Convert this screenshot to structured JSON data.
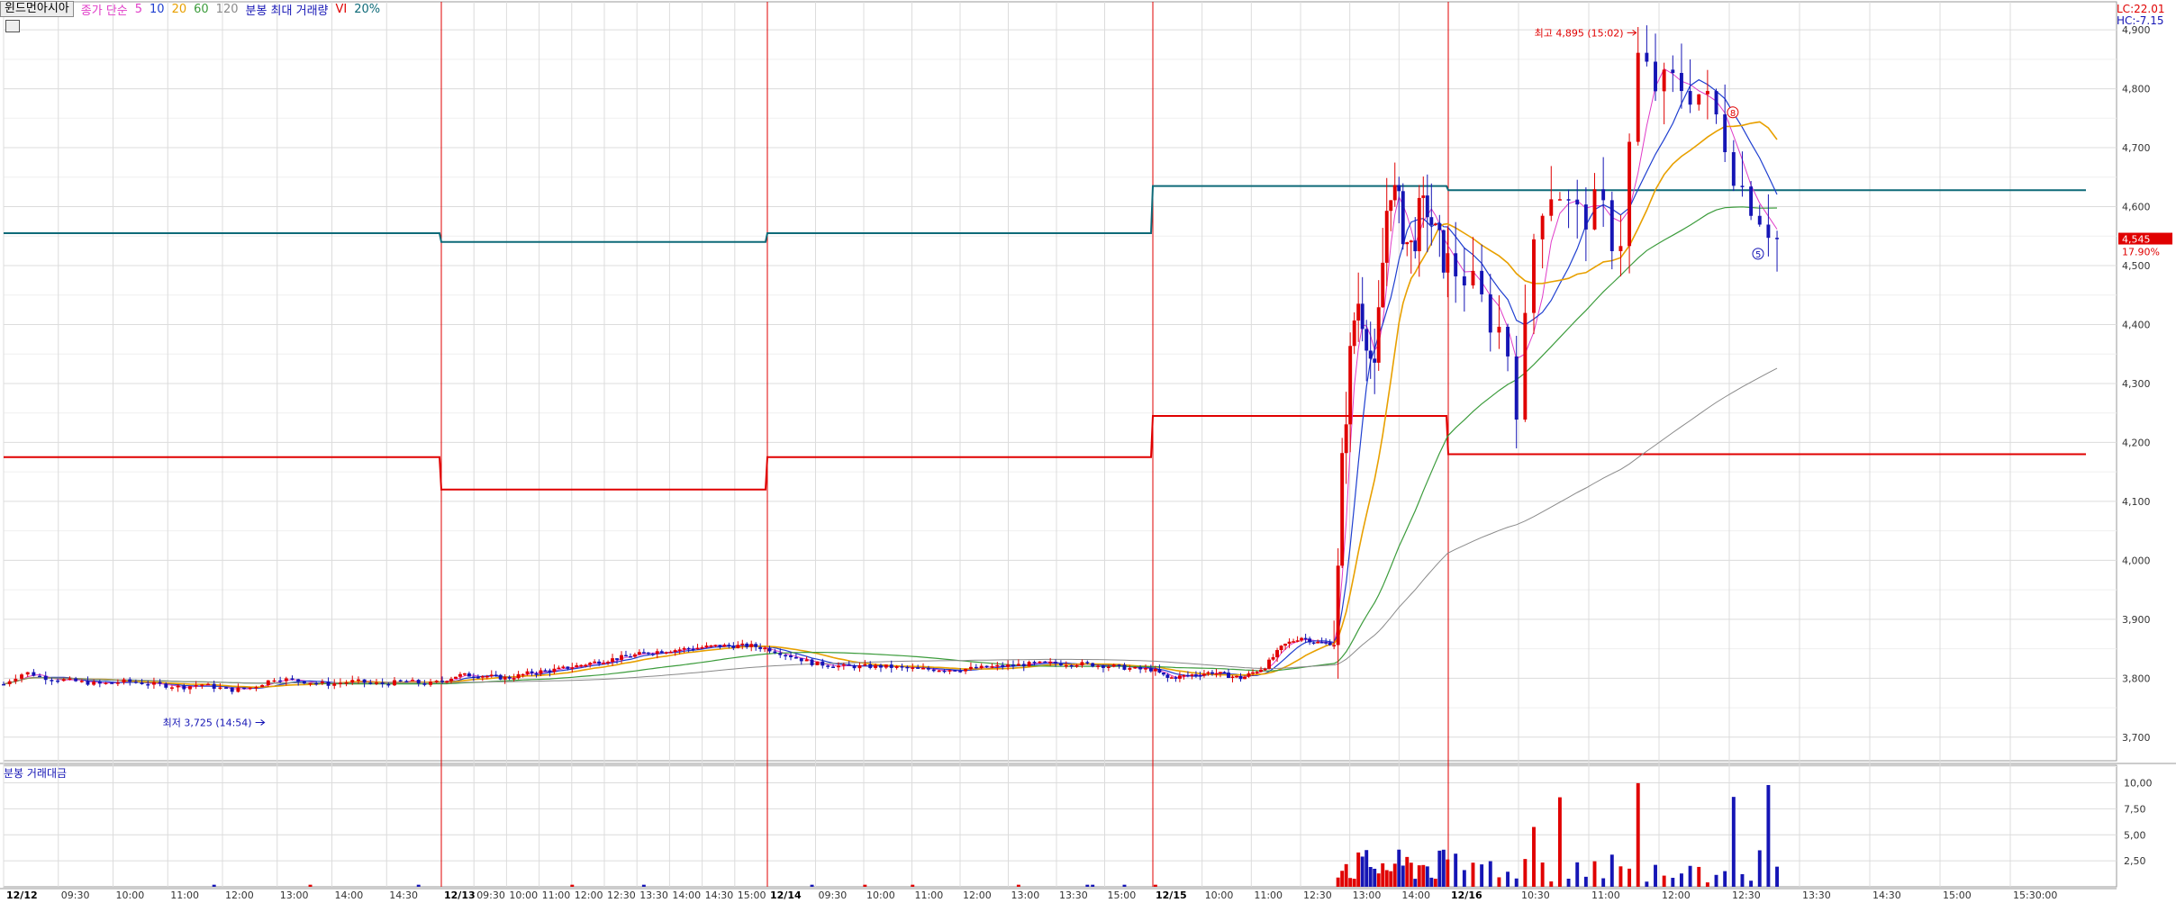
{
  "legend": {
    "stock_name": "윈드먼아시아",
    "ma_label": "종가 단순",
    "ma5": "5",
    "ma10": "10",
    "ma20": "20",
    "ma60": "60",
    "ma120": "120",
    "vol_label": "분봉 최대 거래량",
    "vi_label": "VI",
    "vi_pct": "20%"
  },
  "corner": {
    "lc": "LC:22.01",
    "hc": "HC:-7.15"
  },
  "volume_panel": {
    "label": "분봉 거래대금"
  },
  "colors": {
    "up": "#e00000",
    "down": "#1515b5",
    "ma5": "#e03cc8",
    "ma10": "#1f3fd0",
    "ma20": "#e8a000",
    "ma60": "#3c9c3c",
    "ma120": "#8a8a8a",
    "vi_upper": "#0e6a78",
    "vi_lower": "#e00000",
    "day_sep": "#e00000",
    "grid": "#dcdcdc"
  },
  "chart_data": {
    "type": "candlestick",
    "price_ylim": [
      3660,
      4920
    ],
    "price_ticks": [
      "3,700",
      "3,800",
      "3,900",
      "4,000",
      "4,100",
      "4,200",
      "4,300",
      "4,400",
      "4,500",
      "4,600",
      "4,700",
      "4,800",
      "4,900"
    ],
    "volume_ticks": [
      "2,50",
      "5,00",
      "7,50",
      "10,00"
    ],
    "volume_ylim": [
      0,
      11
    ],
    "current_price": "4,545",
    "current_change": "17.90%",
    "high_note": "최고 4,895 (15:02)",
    "low_note": "최저 3,725 (14:54)",
    "marker_upper": "8",
    "marker_lower": "5",
    "days": [
      "12/12",
      "12/13",
      "12/14",
      "12/15",
      "12/16"
    ],
    "time_labels": [
      {
        "t": "12/12",
        "day": true
      },
      {
        "t": "09:30"
      },
      {
        "t": "10:00"
      },
      {
        "t": "11:00"
      },
      {
        "t": "12:00"
      },
      {
        "t": "13:00"
      },
      {
        "t": "14:00"
      },
      {
        "t": "14:30"
      },
      {
        "t": "12/13",
        "day": true
      },
      {
        "t": "09:30"
      },
      {
        "t": "10:00"
      },
      {
        "t": "11:00"
      },
      {
        "t": "12:00"
      },
      {
        "t": "12:30"
      },
      {
        "t": "13:30"
      },
      {
        "t": "14:00"
      },
      {
        "t": "14:30"
      },
      {
        "t": "15:00"
      },
      {
        "t": "12/14",
        "day": true
      },
      {
        "t": "09:30"
      },
      {
        "t": "10:00"
      },
      {
        "t": "11:00"
      },
      {
        "t": "12:00"
      },
      {
        "t": "13:00"
      },
      {
        "t": "13:30"
      },
      {
        "t": "15:00"
      },
      {
        "t": "12/15",
        "day": true
      },
      {
        "t": "10:00"
      },
      {
        "t": "11:00"
      },
      {
        "t": "12:30"
      },
      {
        "t": "13:00"
      },
      {
        "t": "14:00"
      },
      {
        "t": "12/16",
        "day": true
      },
      {
        "t": "10:30"
      },
      {
        "t": "11:00"
      },
      {
        "t": "12:00"
      },
      {
        "t": "12:30"
      },
      {
        "t": "13:30"
      },
      {
        "t": "14:30"
      },
      {
        "t": "15:00"
      },
      {
        "t": "15:30:00"
      }
    ],
    "vi_upper": [
      {
        "day": "12/12",
        "value": 4555
      },
      {
        "day": "12/13",
        "value": 4540
      },
      {
        "day": "12/14",
        "value": 4555
      },
      {
        "day": "12/15",
        "value": 4635
      },
      {
        "day": "12/16",
        "value": 4628
      }
    ],
    "vi_lower": [
      {
        "day": "12/12",
        "value": 4175
      },
      {
        "day": "12/13",
        "value": 4120
      },
      {
        "day": "12/14",
        "value": 4175
      },
      {
        "day": "12/15",
        "value": 4245
      },
      {
        "day": "12/16",
        "value": 4180
      }
    ],
    "price_path": [
      [
        0,
        3790
      ],
      [
        0.02,
        3800
      ],
      [
        0.05,
        3810
      ],
      [
        0.1,
        3800
      ],
      [
        0.16,
        3795
      ],
      [
        0.22,
        3790
      ],
      [
        0.28,
        3795
      ],
      [
        0.34,
        3790
      ],
      [
        0.41,
        3785
      ],
      [
        0.45,
        3790
      ],
      [
        0.48,
        3785
      ],
      [
        0.52,
        3780
      ],
      [
        0.57,
        3785
      ],
      [
        0.62,
        3800
      ],
      [
        0.68,
        3795
      ],
      [
        0.74,
        3790
      ],
      [
        0.8,
        3795
      ],
      [
        0.86,
        3790
      ],
      [
        0.92,
        3795
      ],
      [
        0.97,
        3790
      ],
      [
        1.0,
        3795
      ],
      [
        1.05,
        3805
      ],
      [
        1.12,
        3805
      ],
      [
        1.2,
        3800
      ],
      [
        1.28,
        3810
      ],
      [
        1.36,
        3815
      ],
      [
        1.45,
        3825
      ],
      [
        1.55,
        3835
      ],
      [
        1.65,
        3845
      ],
      [
        1.75,
        3850
      ],
      [
        1.85,
        3855
      ],
      [
        1.95,
        3855
      ],
      [
        2.0,
        3850
      ],
      [
        2.05,
        3840
      ],
      [
        2.12,
        3825
      ],
      [
        2.2,
        3820
      ],
      [
        2.3,
        3820
      ],
      [
        2.4,
        3815
      ],
      [
        2.5,
        3815
      ],
      [
        2.6,
        3820
      ],
      [
        2.7,
        3825
      ],
      [
        2.8,
        3825
      ],
      [
        2.9,
        3820
      ],
      [
        2.96,
        3815
      ],
      [
        3.0,
        3815
      ],
      [
        3.05,
        3800
      ],
      [
        3.12,
        3805
      ],
      [
        3.2,
        3810
      ],
      [
        3.3,
        3800
      ],
      [
        3.38,
        3820
      ],
      [
        3.44,
        3855
      ],
      [
        3.5,
        3870
      ],
      [
        3.56,
        3860
      ],
      [
        3.6,
        3860
      ],
      [
        3.62,
        3880
      ],
      [
        3.64,
        4150
      ],
      [
        3.66,
        4300
      ],
      [
        3.69,
        4450
      ],
      [
        3.72,
        4400
      ],
      [
        3.75,
        4300
      ],
      [
        3.77,
        4450
      ],
      [
        3.8,
        4650
      ],
      [
        3.83,
        4600
      ],
      [
        3.87,
        4520
      ],
      [
        3.9,
        4580
      ],
      [
        3.93,
        4600
      ],
      [
        3.96,
        4540
      ],
      [
        4.0,
        4500
      ],
      [
        4.03,
        4480
      ],
      [
        4.06,
        4420
      ],
      [
        4.09,
        4380
      ],
      [
        4.11,
        4260
      ],
      [
        4.14,
        4600
      ],
      [
        4.17,
        4640
      ],
      [
        4.2,
        4580
      ],
      [
        4.24,
        4600
      ],
      [
        4.27,
        4520
      ],
      [
        4.3,
        4850
      ],
      [
        4.33,
        4800
      ],
      [
        4.36,
        4810
      ],
      [
        4.4,
        4790
      ],
      [
        4.43,
        4740
      ],
      [
        4.46,
        4640
      ],
      [
        4.5,
        4580
      ],
      [
        4.52,
        4545
      ]
    ]
  }
}
